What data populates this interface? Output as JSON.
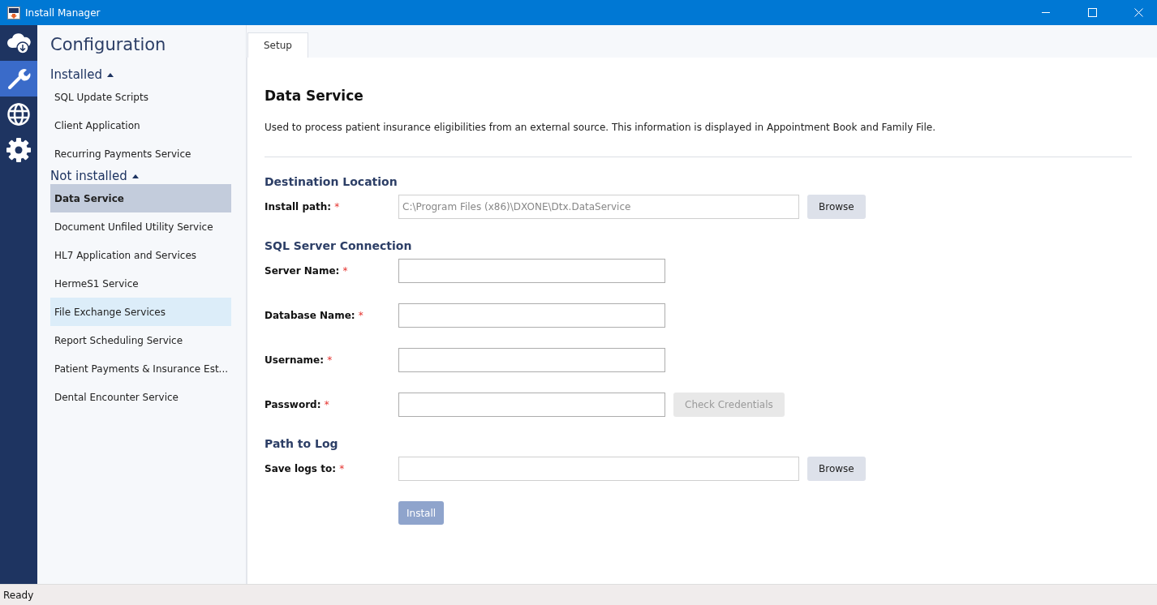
{
  "window": {
    "title": "Install Manager"
  },
  "rail": [
    {
      "kind": "cloud",
      "selected": false
    },
    {
      "kind": "wrench",
      "selected": true
    },
    {
      "kind": "globe",
      "selected": false
    },
    {
      "kind": "gear",
      "selected": false
    }
  ],
  "sidebar": {
    "title": "Configuration",
    "groups": [
      {
        "label": "Installed",
        "expanded": true,
        "items": [
          {
            "label": "SQL Update Scripts",
            "selected": false,
            "hovered": false
          },
          {
            "label": "Client Application",
            "selected": false,
            "hovered": false
          },
          {
            "label": "Recurring Payments Service",
            "selected": false,
            "hovered": false
          }
        ]
      },
      {
        "label": "Not installed",
        "expanded": true,
        "items": [
          {
            "label": "Data Service",
            "selected": true,
            "hovered": false
          },
          {
            "label": "Document Unfiled Utility Service",
            "selected": false,
            "hovered": false
          },
          {
            "label": "HL7 Application and Services",
            "selected": false,
            "hovered": false
          },
          {
            "label": "HermeS1 Service",
            "selected": false,
            "hovered": false
          },
          {
            "label": "File Exchange Services",
            "selected": false,
            "hovered": true
          },
          {
            "label": "Report Scheduling Service",
            "selected": false,
            "hovered": false
          },
          {
            "label": "Patient Payments & Insurance Est...",
            "selected": false,
            "hovered": false
          },
          {
            "label": "Dental Encounter Service",
            "selected": false,
            "hovered": false
          }
        ]
      }
    ]
  },
  "tabs": [
    {
      "label": "Setup",
      "selected": true
    }
  ],
  "content": {
    "title": "Data Service",
    "description": "Used to process patient insurance eligibilities from an external source. This information is displayed in Appointment Book and Family File.",
    "sections": [
      {
        "title": "Destination Location",
        "rows": [
          {
            "label": "Install path:",
            "required": "*",
            "value": "C:\\Program Files (x86)\\DXONE\\Dtx.DataService",
            "kind": "path",
            "button": {
              "label": "Browse",
              "disabled": false
            }
          }
        ]
      },
      {
        "title": "SQL Server Connection",
        "rows": [
          {
            "label": "Server Name:",
            "required": "*",
            "value": "",
            "kind": "text"
          },
          {
            "label": "Database Name:",
            "required": "*",
            "value": "",
            "kind": "text"
          },
          {
            "label": "Username:",
            "required": "*",
            "value": "",
            "kind": "text"
          },
          {
            "label": "Password:",
            "required": "*",
            "value": "",
            "kind": "text",
            "button": {
              "label": "Check Credentials",
              "disabled": true
            }
          }
        ]
      },
      {
        "title": "Path to Log",
        "rows": [
          {
            "label": "Save logs to:",
            "required": "*",
            "value": "",
            "kind": "path",
            "button": {
              "label": "Browse",
              "disabled": false
            }
          }
        ]
      }
    ],
    "install": {
      "label": "Install",
      "disabled": true
    }
  },
  "status_bar": {
    "text": "Ready"
  }
}
